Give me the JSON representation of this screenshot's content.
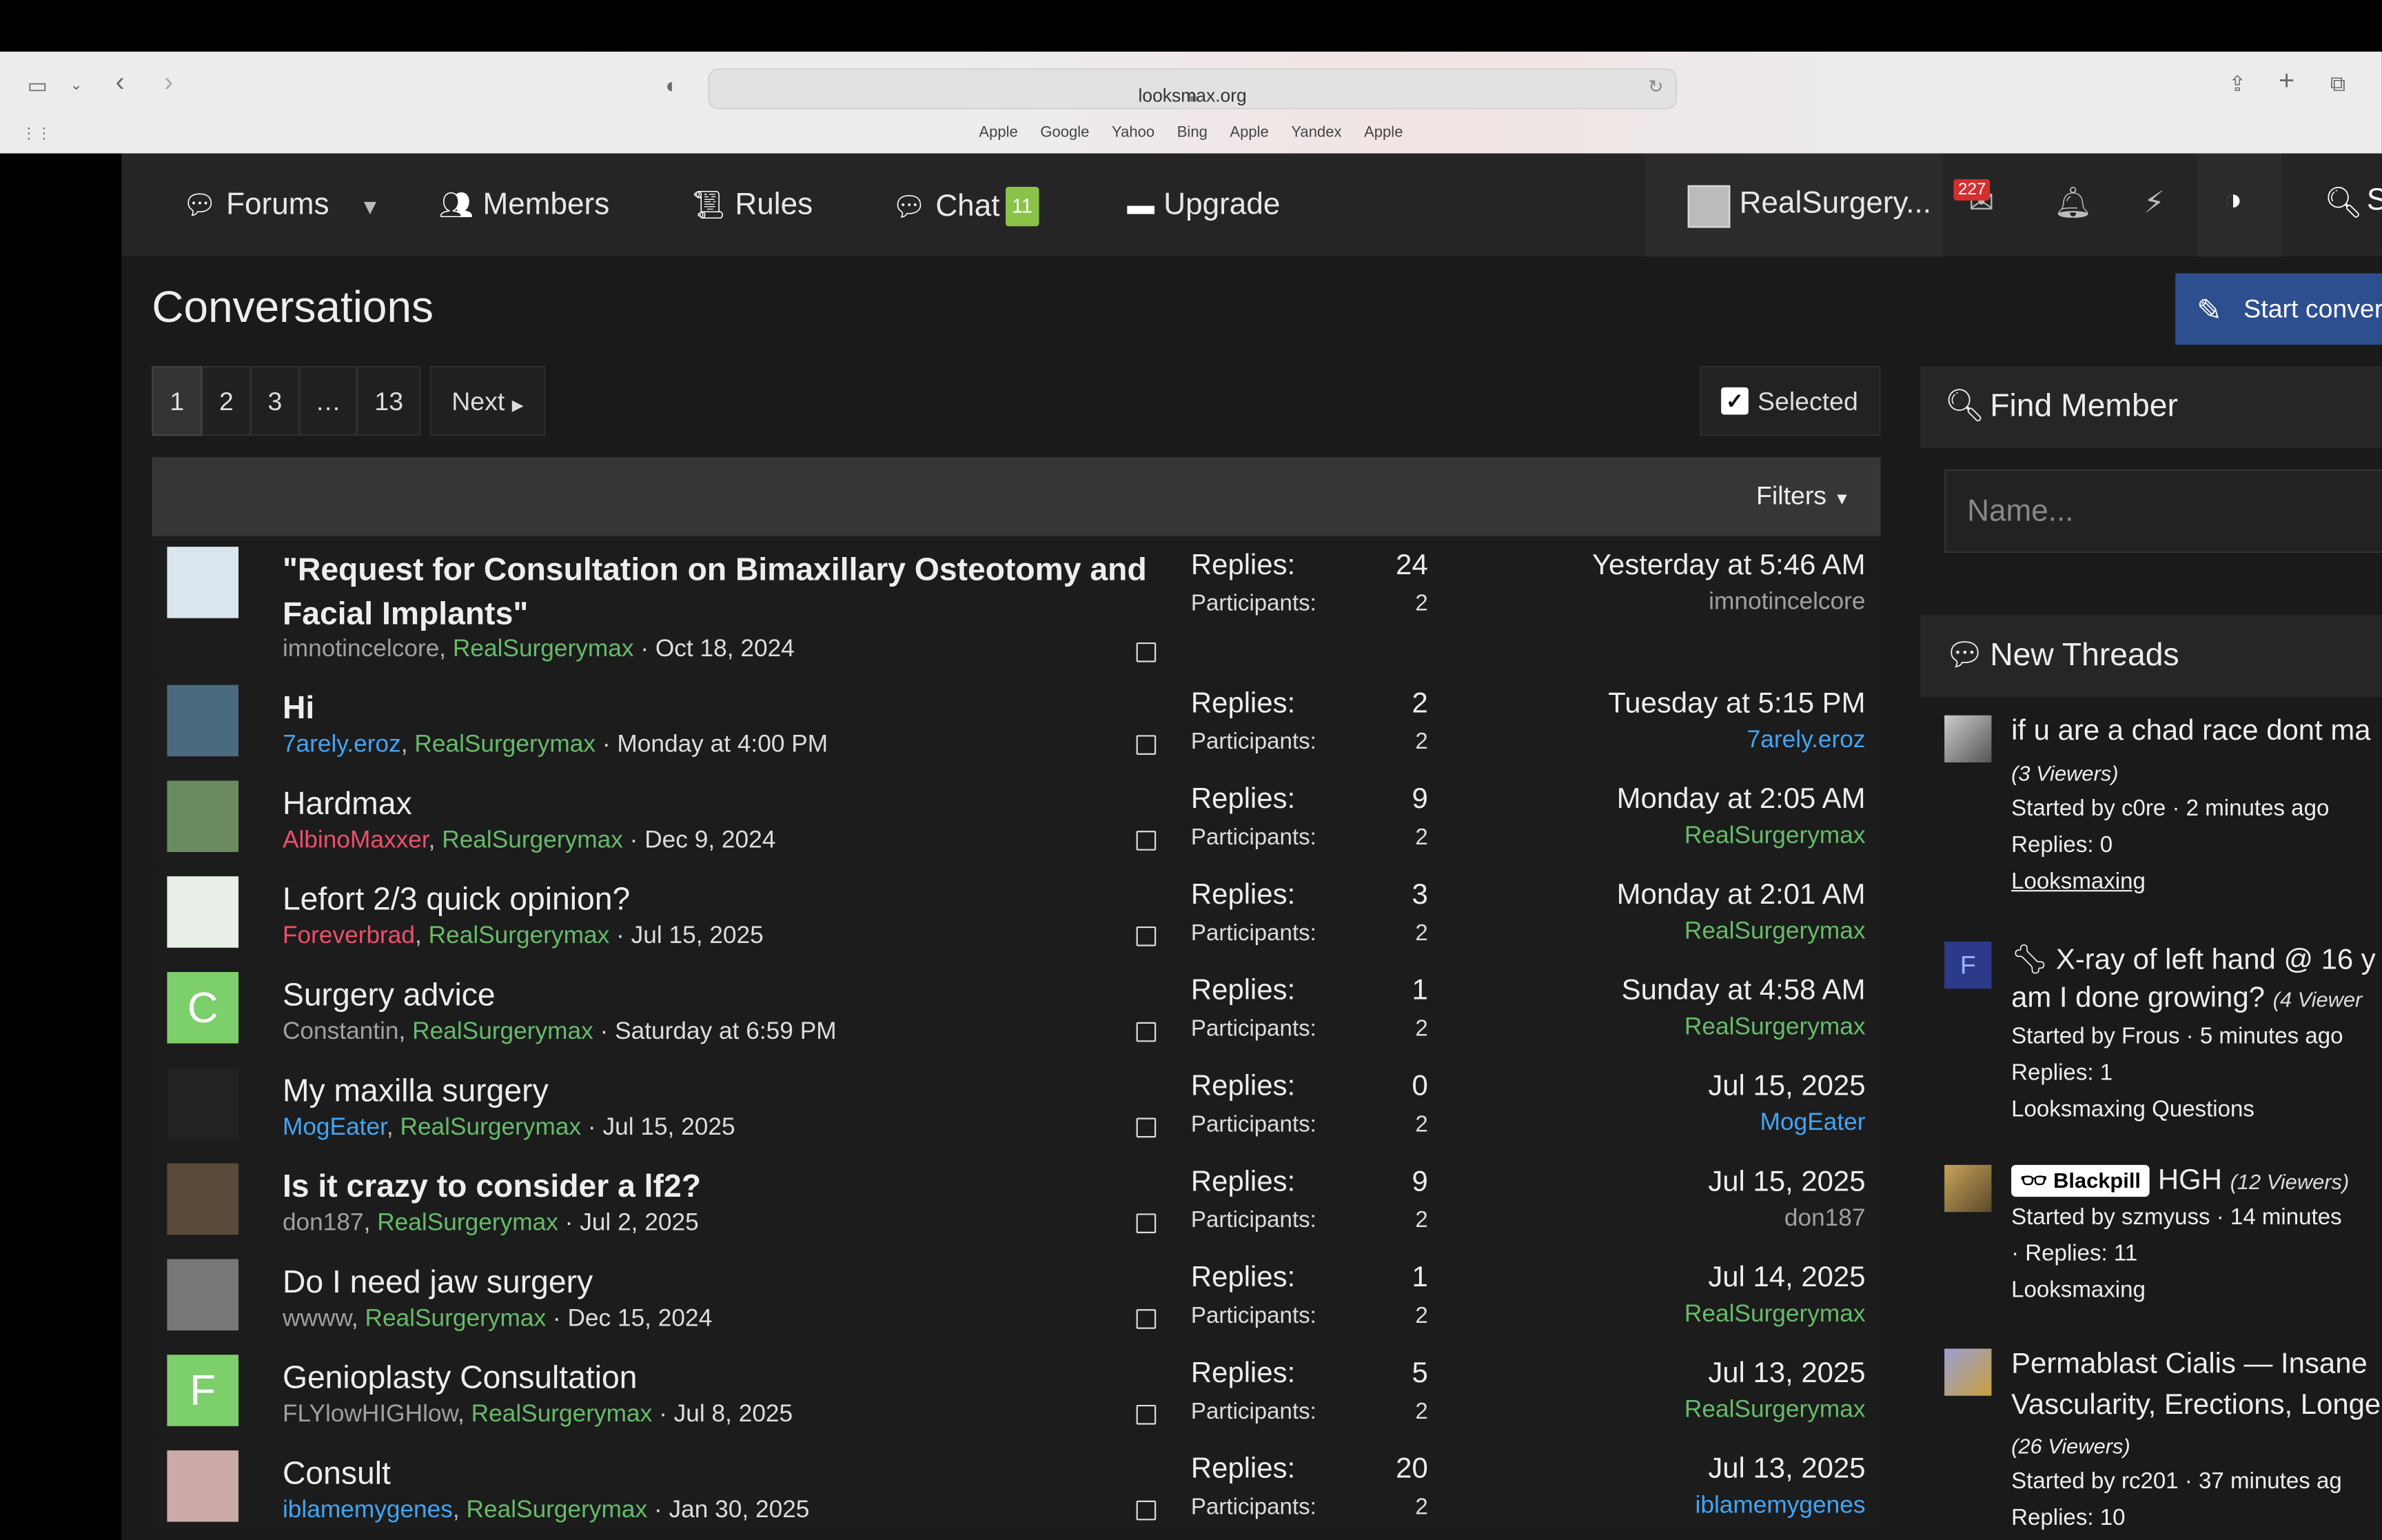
{
  "browser": {
    "url": "looksmax.org",
    "favorites": [
      "Apple",
      "Google",
      "Yahoo",
      "Bing",
      "Apple",
      "Yandex",
      "Apple"
    ]
  },
  "nav": {
    "forums": "Forums",
    "members": "Members",
    "rules": "Rules",
    "chat": "Chat",
    "chat_badge": "11",
    "upgrade": "Upgrade",
    "username": "RealSurgery...",
    "mail_badge": "227",
    "search_partial": "S"
  },
  "page": {
    "title": "Conversations",
    "start_button": "Start conver"
  },
  "pager": {
    "pages": [
      "1",
      "2",
      "3",
      "…",
      "13"
    ],
    "next": "Next",
    "current": "1"
  },
  "selected_label": "Selected",
  "filters_label": "Filters",
  "labels": {
    "replies": "Replies:",
    "participants": "Participants:"
  },
  "conversations": [
    {
      "title": "\"Request for Consultation on Bimaxillary Osteotomy and Facial Implants\"",
      "bold": true,
      "author": "imnotincelcore",
      "author_color": "grey",
      "partner": "RealSurgerymax",
      "date": "· Oct 18, 2024",
      "replies": "24",
      "participants": "2",
      "last_date": "Yesterday at 5:46 AM",
      "last_user": "imnotincelcore",
      "last_color": "grey"
    },
    {
      "title": "Hi",
      "bold": true,
      "author": "7arely.eroz",
      "author_color": "blue",
      "partner": "RealSurgerymax",
      "date": "· Monday at 4:00 PM",
      "replies": "2",
      "participants": "2",
      "last_date": "Tuesday at 5:15 PM",
      "last_user": "7arely.eroz",
      "last_color": "blue"
    },
    {
      "title": "Hardmax",
      "bold": false,
      "author": "AlbinoMaxxer",
      "author_color": "red",
      "partner": "RealSurgerymax",
      "date": "· Dec 9, 2024",
      "replies": "9",
      "participants": "2",
      "last_date": "Monday at 2:05 AM",
      "last_user": "RealSurgerymax",
      "last_color": "green"
    },
    {
      "title": "Lefort 2/3 quick opinion?",
      "bold": false,
      "author": "Foreverbrad",
      "author_color": "red",
      "partner": "RealSurgerymax",
      "date": "· Jul 15, 2025",
      "replies": "3",
      "participants": "2",
      "last_date": "Monday at 2:01 AM",
      "last_user": "RealSurgerymax",
      "last_color": "green"
    },
    {
      "title": "Surgery advice",
      "bold": false,
      "author": "Constantin",
      "author_color": "grey",
      "partner": "RealSurgerymax",
      "date": "· Saturday at 6:59 PM",
      "replies": "1",
      "participants": "2",
      "last_date": "Sunday at 4:58 AM",
      "last_user": "RealSurgerymax",
      "last_color": "green"
    },
    {
      "title": "My maxilla surgery",
      "bold": false,
      "author": "MogEater",
      "author_color": "blue",
      "partner": "RealSurgerymax",
      "date": "· Jul 15, 2025",
      "replies": "0",
      "participants": "2",
      "last_date": "Jul 15, 2025",
      "last_user": "MogEater",
      "last_color": "blue"
    },
    {
      "title": "Is it crazy to consider a lf2?",
      "bold": true,
      "author": "don187",
      "author_color": "grey",
      "partner": "RealSurgerymax",
      "date": "· Jul 2, 2025",
      "replies": "9",
      "participants": "2",
      "last_date": "Jul 15, 2025",
      "last_user": "don187",
      "last_color": "grey"
    },
    {
      "title": "Do I need jaw surgery",
      "bold": false,
      "author": "wwww",
      "author_color": "grey",
      "partner": "RealSurgerymax",
      "date": "· Dec 15, 2024",
      "replies": "1",
      "participants": "2",
      "last_date": "Jul 14, 2025",
      "last_user": "RealSurgerymax",
      "last_color": "green"
    },
    {
      "title": "Genioplasty Consultation",
      "bold": false,
      "author": "FLYlowHIGHlow",
      "author_color": "grey",
      "partner": "RealSurgerymax",
      "date": "· Jul 8, 2025",
      "replies": "5",
      "participants": "2",
      "last_date": "Jul 13, 2025",
      "last_user": "RealSurgerymax",
      "last_color": "green"
    },
    {
      "title": "Consult",
      "bold": false,
      "author": "iblamemygenes",
      "author_color": "blue",
      "partner": "RealSurgerymax",
      "date": "· Jan 30, 2025",
      "replies": "20",
      "participants": "2",
      "last_date": "Jul 13, 2025",
      "last_user": "iblamemygenes",
      "last_color": "blue"
    }
  ],
  "sidebar": {
    "find_member": "Find Member",
    "name_placeholder": "Name...",
    "new_threads": "New Threads",
    "threads": [
      {
        "l1": "if u are a chad race dont ma",
        "l2": "(3 Viewers)",
        "l3": "Started by c0re · 2 minutes ago",
        "l4": "Replies: 0",
        "l5": "Looksmaxing"
      },
      {
        "l1": "X-ray of left hand @ 16 y",
        "l2a": "am I done growing?",
        "l2b": "(4 Viewer",
        "l3": "Started by Frous · 5 minutes ago",
        "l4": "Replies: 1",
        "l5": "Looksmaxing Questions",
        "avatar_letter": "F"
      },
      {
        "tag": "Blackpill",
        "l1": "HGH",
        "l1b": "(12 Viewers)",
        "l3": "Started by szmyuss · 14 minutes",
        "l4": "· Replies: 11",
        "l5": "Looksmaxing"
      },
      {
        "l1": "Permablast Cialis — Insane",
        "l2": "Vascularity, Erections, Longe",
        "l3i": "(26 Viewers)",
        "l3": "Started by rc201 · 37 minutes ag",
        "l4": "Replies: 10"
      }
    ]
  },
  "colors": {
    "green": "#66bb6a",
    "blue": "#42a5f5",
    "red": "#ef4f6a",
    "accent": "#2e4f8f"
  }
}
